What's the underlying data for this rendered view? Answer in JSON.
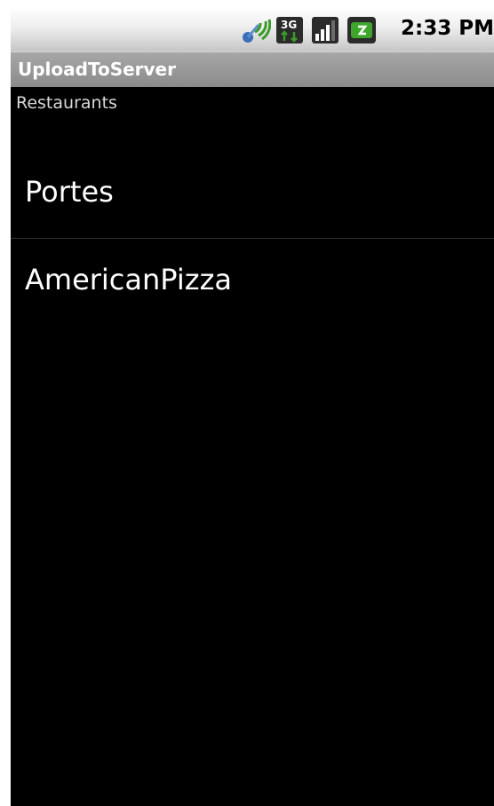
{
  "status_bar": {
    "time": "2:33 PM",
    "icons": [
      "gps-signal-icon",
      "3g-data-icon",
      "signal-strength-icon",
      "battery-icon"
    ]
  },
  "app": {
    "title": "UploadToServer"
  },
  "subheader": "Restaurants",
  "list": {
    "items": [
      {
        "label": "Portes"
      },
      {
        "label": "AmericanPizza"
      }
    ]
  },
  "colors": {
    "background": "#000000",
    "title_bar": "#9a9a9a",
    "status_bar": "#e6e6e6",
    "item_text": "#ffffff",
    "battery_green": "#3fa62c"
  }
}
